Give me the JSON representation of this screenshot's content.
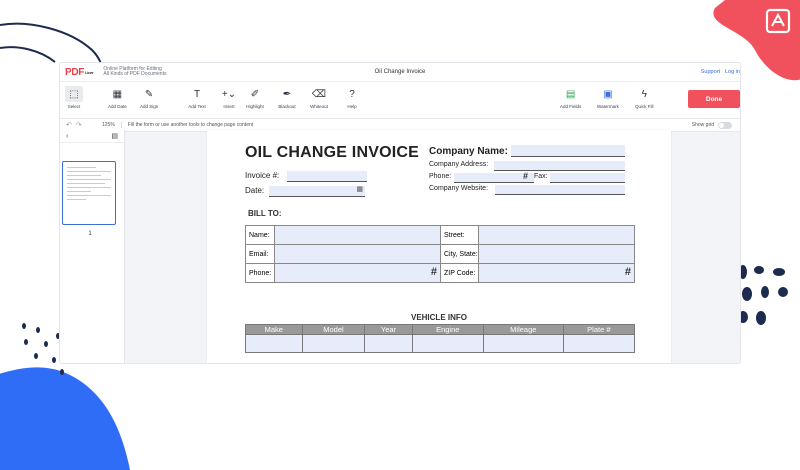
{
  "header": {
    "logo": "PDF",
    "logo_sub": "Liner",
    "tagline_1": "Online Platform for Editing",
    "tagline_2": "All Kinds of PDF Documents",
    "doc_title": "Oil Change Invoice",
    "support": "Support",
    "login": "Log in"
  },
  "toolbar": {
    "select": "Select",
    "add_date": "Add Date",
    "add_sign": "Add Sign",
    "add_text": "Add Text",
    "insert": "Insert",
    "highlight": "Highlight",
    "blackout": "Blackout",
    "whiteout": "Whiteout",
    "help": "Help",
    "add_fields": "Add Fields",
    "watermark": "Watermark",
    "quick_fill": "Quick Fill",
    "done": "Done"
  },
  "subbar": {
    "zoom": "125%",
    "hint": "Fill the form or use another tools to change page content",
    "show_grid": "Show grid"
  },
  "sidebar": {
    "page_number": "1"
  },
  "document": {
    "title": "OIL CHANGE INVOICE",
    "invoice_label": "Invoice #:",
    "date_label": "Date:",
    "company_name_label": "Company Name:",
    "company_address_label": "Company Address:",
    "phone_label": "Phone:",
    "fax_label": "Fax:",
    "company_website_label": "Company Website:",
    "bill_to": "BILL TO:",
    "name_label": "Name:",
    "street_label": "Street:",
    "email_label": "Email:",
    "city_state_label": "City, State:",
    "zip_label": "ZIP Code:",
    "hash": "#",
    "vehicle_info": "VEHICLE INFO",
    "vehicle_columns": [
      "Make",
      "Model",
      "Year",
      "Engine",
      "Mileage",
      "Plate #"
    ]
  },
  "colors": {
    "accent_red": "#f0515c",
    "link_blue": "#3d6fd8",
    "field_fill": "#e6ecfa",
    "deco_blue": "#2f6df6",
    "deco_navy": "#1d2b4f"
  }
}
